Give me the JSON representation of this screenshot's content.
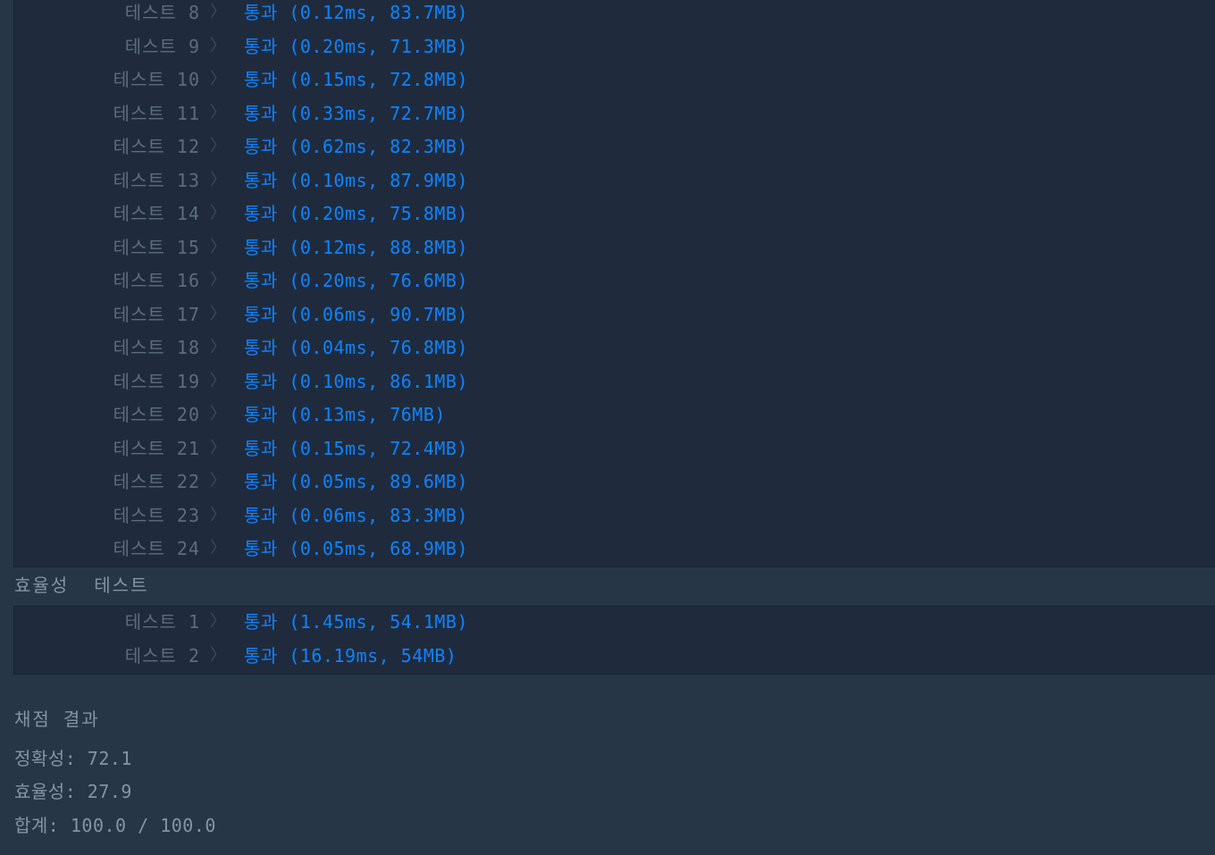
{
  "accuracy_tests": [
    {
      "label": "테스트 8",
      "status": "통과 (0.12ms, 83.7MB)"
    },
    {
      "label": "테스트 9",
      "status": "통과 (0.20ms, 71.3MB)"
    },
    {
      "label": "테스트 10",
      "status": "통과 (0.15ms, 72.8MB)"
    },
    {
      "label": "테스트 11",
      "status": "통과 (0.33ms, 72.7MB)"
    },
    {
      "label": "테스트 12",
      "status": "통과 (0.62ms, 82.3MB)"
    },
    {
      "label": "테스트 13",
      "status": "통과 (0.10ms, 87.9MB)"
    },
    {
      "label": "테스트 14",
      "status": "통과 (0.20ms, 75.8MB)"
    },
    {
      "label": "테스트 15",
      "status": "통과 (0.12ms, 88.8MB)"
    },
    {
      "label": "테스트 16",
      "status": "통과 (0.20ms, 76.6MB)"
    },
    {
      "label": "테스트 17",
      "status": "통과 (0.06ms, 90.7MB)"
    },
    {
      "label": "테스트 18",
      "status": "통과 (0.04ms, 76.8MB)"
    },
    {
      "label": "테스트 19",
      "status": "통과 (0.10ms, 86.1MB)"
    },
    {
      "label": "테스트 20",
      "status": "통과 (0.13ms, 76MB)"
    },
    {
      "label": "테스트 21",
      "status": "통과 (0.15ms, 72.4MB)"
    },
    {
      "label": "테스트 22",
      "status": "통과 (0.05ms, 89.6MB)"
    },
    {
      "label": "테스트 23",
      "status": "통과 (0.06ms, 83.3MB)"
    },
    {
      "label": "테스트 24",
      "status": "통과 (0.05ms, 68.9MB)"
    }
  ],
  "efficiency_section_title": "효율성  테스트",
  "efficiency_tests": [
    {
      "label": "테스트 1",
      "status": "통과 (1.45ms, 54.1MB)"
    },
    {
      "label": "테스트 2",
      "status": "통과 (16.19ms, 54MB)"
    }
  ],
  "chevron_glyph": "〉",
  "icons": {
    "chevron": "chevron-right-icon"
  },
  "colors": {
    "pass": "#0f83ff",
    "background": "#263647",
    "panel": "#1f2b3d"
  },
  "summary": {
    "title": "채점 결과",
    "accuracy": "정확성: 72.1",
    "efficiency": "효율성: 27.9",
    "total": "합계: 100.0 / 100.0"
  }
}
